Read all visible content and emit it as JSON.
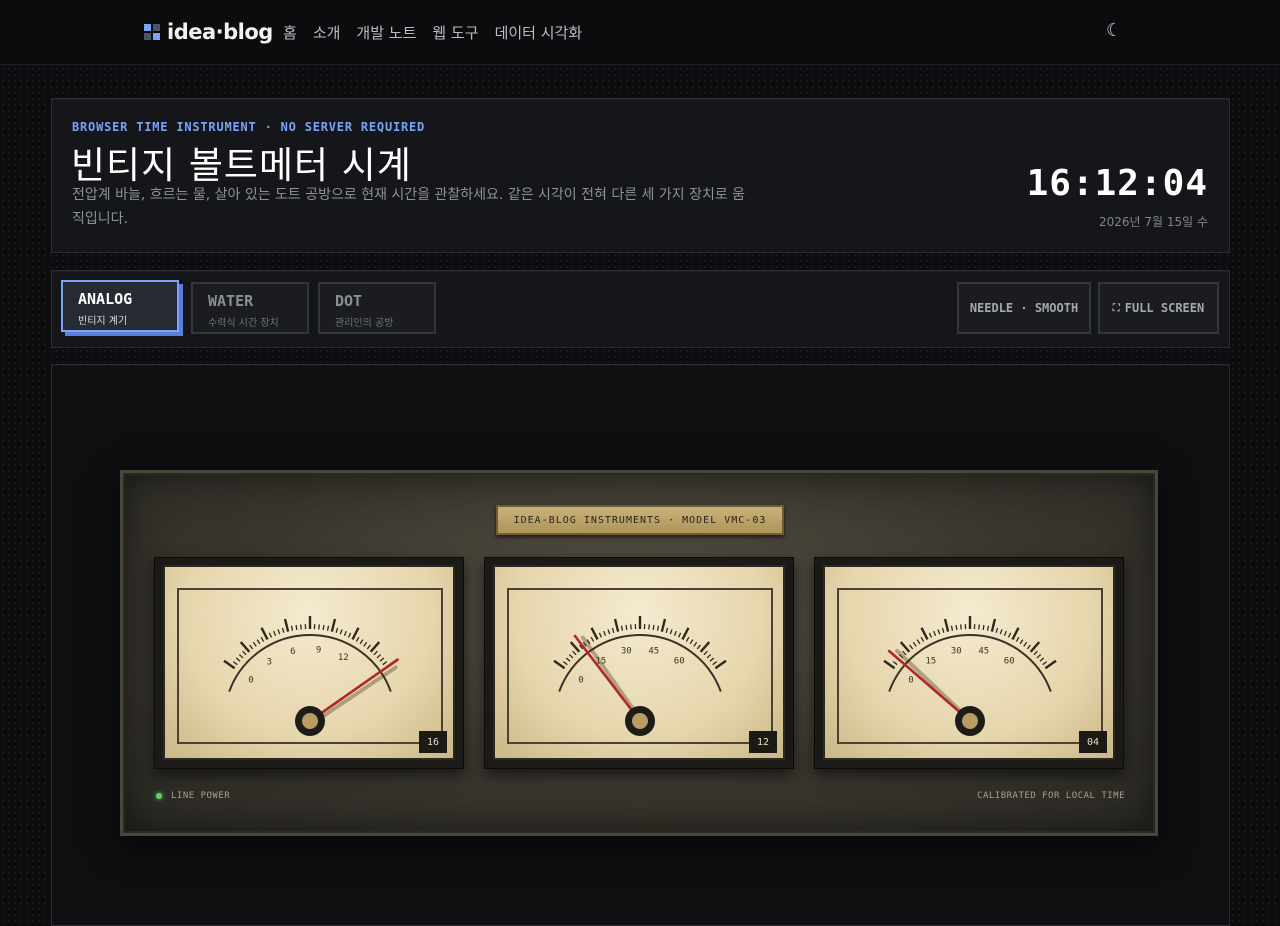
{
  "nav": {
    "logo_text": "idea·blog",
    "items": [
      "홈",
      "소개",
      "개발 노트",
      "웹 도구",
      "데이터 시각화"
    ],
    "theme_icon": "moon-icon"
  },
  "hero": {
    "eyebrow": "BROWSER TIME INSTRUMENT · NO SERVER REQUIRED",
    "title": "빈티지 볼트메터 시계",
    "description": "전압계 바늘, 흐르는 물, 살아 있는 도트 공방으로 현재 시간을 관찰하세요. 같은 시각이 전혀 다른 세 가지 장치로 움직입니다.",
    "time": "16:12:04",
    "date": "2026년 7월 15일 수"
  },
  "controls": {
    "modes": [
      {
        "label": "ANALOG",
        "sub": "빈티지 계기",
        "active": true
      },
      {
        "label": "WATER",
        "sub": "수력식 시간 장치",
        "active": false
      },
      {
        "label": "DOT",
        "sub": "관리인의 공방",
        "active": false
      }
    ],
    "needle_label": "NEEDLE · SMOOTH",
    "fullscreen_label": "FULL SCREEN",
    "fullscreen_icon": "expand-icon"
  },
  "instrument": {
    "plate": "IDEA-BLOG INSTRUMENTS · MODEL VMC-03",
    "status": "LINE POWER",
    "calibration": "CALIBRATED FOR LOCAL TIME",
    "colors": {
      "needle": "#b3262b",
      "face": "#ecdfbd",
      "plate": "#c2aa70",
      "led": "#5ed36a"
    },
    "meters": [
      {
        "unit": "hours",
        "max": 16,
        "value": 16,
        "labels": [
          "0",
          "3",
          "6",
          "9",
          "12"
        ],
        "label_values": [
          0,
          3,
          6,
          9,
          12
        ],
        "readout": "16"
      },
      {
        "unit": "minutes",
        "max": 75,
        "value": 12,
        "labels": [
          "0",
          "15",
          "30",
          "45",
          "60"
        ],
        "label_values": [
          0,
          15,
          30,
          45,
          60
        ],
        "readout": "12"
      },
      {
        "unit": "seconds",
        "max": 75,
        "value": 4,
        "labels": [
          "0",
          "15",
          "30",
          "45",
          "60"
        ],
        "label_values": [
          0,
          15,
          30,
          45,
          60
        ],
        "readout": "04"
      }
    ]
  }
}
